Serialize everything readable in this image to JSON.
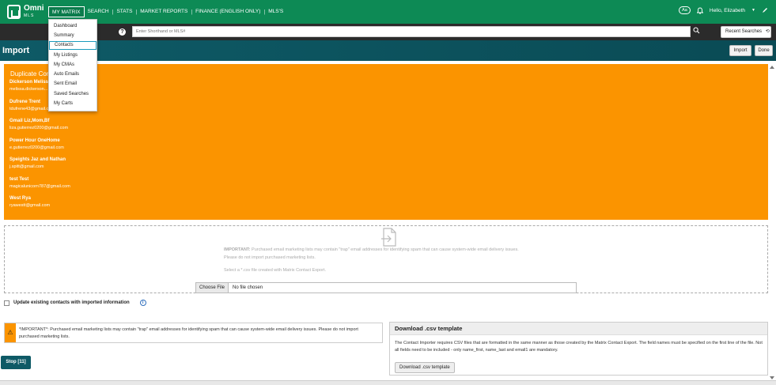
{
  "brand": {
    "name": "Omni",
    "sub": "MLS"
  },
  "nav": {
    "items": [
      "MY MATRIX",
      "SEARCH",
      "STATS",
      "MARKET REPORTS",
      "FINANCE (ENGLISH ONLY)",
      "MLS'S"
    ]
  },
  "topright": {
    "aa": "Aa",
    "greeting": "Hello, Elizabeth"
  },
  "search": {
    "placeholder": "Enter Shorthand or MLS#",
    "recent_label": "Recent Searches"
  },
  "page": {
    "title": "Import",
    "import_label": "Import",
    "done_label": "Done"
  },
  "dropdown": {
    "items": [
      "Dashboard",
      "Summary",
      "Contacts",
      "My Listings",
      "My CMAs",
      "Auto Emails",
      "Sent Email",
      "Saved Searches",
      "My Carts"
    ],
    "active_index": 2
  },
  "duplicates": {
    "title": "Duplicate Contacts",
    "contacts": [
      {
        "name": "Dickerson Melissa",
        "email": "melissa.dickerson..."
      },
      {
        "name": "Dufrene Trent",
        "email": "tdufrene43@gmail.com"
      },
      {
        "name": "Gmail Liz,Mom,Bf",
        "email": "liza.gutierrez0200@gmail.com"
      },
      {
        "name": "Power Hour OneHome",
        "email": "e.gutierrez0200@gmail.com"
      },
      {
        "name": "Speights Jaz and Nathan",
        "email": "j.spitt@gmail.com"
      },
      {
        "name": "test Test",
        "email": "magicalunicorn787@gmail.com"
      },
      {
        "name": "West Rya",
        "email": "ryawestt@gmail.com"
      }
    ]
  },
  "upload": {
    "important_bold": "IMPORTANT:",
    "important_text": "Purchased email marketing lists may contain \"trap\" email addresses for identifying spam that can cause system-wide email delivery issues.",
    "important_line2": "Please do not import purchased marketing lists.",
    "select_text": "Select a *.csv file created with Matrix Contact Export.",
    "choose_label": "Choose File",
    "no_file": "No file chosen"
  },
  "update": {
    "label": "Update existing contacts with imported information"
  },
  "warning": {
    "text": "*IMPORTANT*: Purchased email marketing lists may contain \"trap\" email addresses for identifying spam that can cause system-wide email delivery issues. Please do not import purchased marketing lists."
  },
  "csv": {
    "title": "Download .csv template",
    "body": "The Contact Importer requires CSV files that are formatted in the same manner as those created by the Matrix Contact Export. The field names must be specified on the first line of the file. Not all fields need to be included - only name_first, name_last and email1 are mandatory.",
    "button": "Download .csv template"
  },
  "stop": {
    "label": "Stop [11]"
  },
  "colors": {
    "brand_green": "#0d8a55",
    "teal": "#0e5a66",
    "orange": "#fb9400"
  }
}
